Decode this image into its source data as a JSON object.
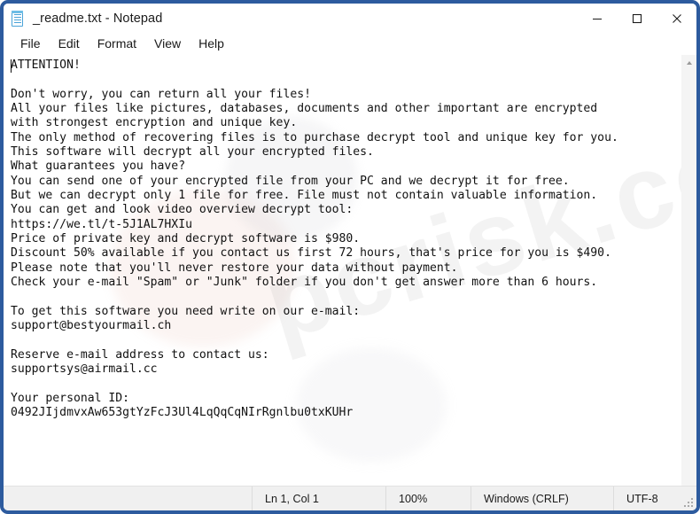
{
  "window": {
    "title": "_readme.txt - Notepad",
    "app_icon": "notepad-icon",
    "controls": {
      "minimize": "minimize-icon",
      "maximize": "maximize-icon",
      "close": "close-icon"
    },
    "border_color": "#2d5b9e"
  },
  "menubar": {
    "items": [
      {
        "label": "File"
      },
      {
        "label": "Edit"
      },
      {
        "label": "Format"
      },
      {
        "label": "View"
      },
      {
        "label": "Help"
      }
    ]
  },
  "editor": {
    "content": "ATTENTION!\n\nDon't worry, you can return all your files!\nAll your files like pictures, databases, documents and other important are encrypted\nwith strongest encryption and unique key.\nThe only method of recovering files is to purchase decrypt tool and unique key for you.\nThis software will decrypt all your encrypted files.\nWhat guarantees you have?\nYou can send one of your encrypted file from your PC and we decrypt it for free.\nBut we can decrypt only 1 file for free. File must not contain valuable information.\nYou can get and look video overview decrypt tool:\nhttps://we.tl/t-5J1AL7HXIu\nPrice of private key and decrypt software is $980.\nDiscount 50% available if you contact us first 72 hours, that's price for you is $490.\nPlease note that you'll never restore your data without payment.\nCheck your e-mail \"Spam\" or \"Junk\" folder if you don't get answer more than 6 hours.\n\nTo get this software you need write on our e-mail:\nsupport@bestyourmail.ch\n\nReserve e-mail address to contact us:\nsupportsys@airmail.cc\n\nYour personal ID:\n0492JIjdmvxAw653gtYzFcJ3Ul4LqQqCqNIrRgnlbu0txKUHr",
    "watermark_text": "pcrisk.com"
  },
  "scrollbar": {
    "up_arrow": "scroll-up-arrow-icon"
  },
  "statusbar": {
    "position": "Ln 1, Col 1",
    "zoom": "100%",
    "line_ending": "Windows (CRLF)",
    "encoding": "UTF-8"
  }
}
